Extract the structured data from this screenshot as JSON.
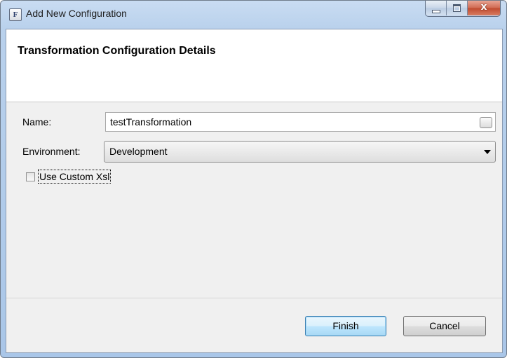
{
  "window": {
    "title": "Add New Configuration",
    "app_icon_letter": "F",
    "close_glyph": "x"
  },
  "header": {
    "title": "Transformation Configuration Details"
  },
  "form": {
    "name_label": "Name:",
    "name_value": "testTransformation",
    "environment_label": "Environment:",
    "environment_value": "Development",
    "custom_xsl_label": "Use Custom Xsl",
    "custom_xsl_checked": false
  },
  "buttons": {
    "finish": "Finish",
    "cancel": "Cancel"
  },
  "icons": {
    "app": "app-f-icon",
    "minimize": "minimize-icon",
    "maximize": "maximize-icon",
    "close": "close-icon",
    "dropdown": "chevron-down-icon"
  },
  "colors": {
    "title_bar": "#b9d1ec",
    "close_button": "#c04a2f",
    "default_button_accent": "#3c7fb1"
  }
}
